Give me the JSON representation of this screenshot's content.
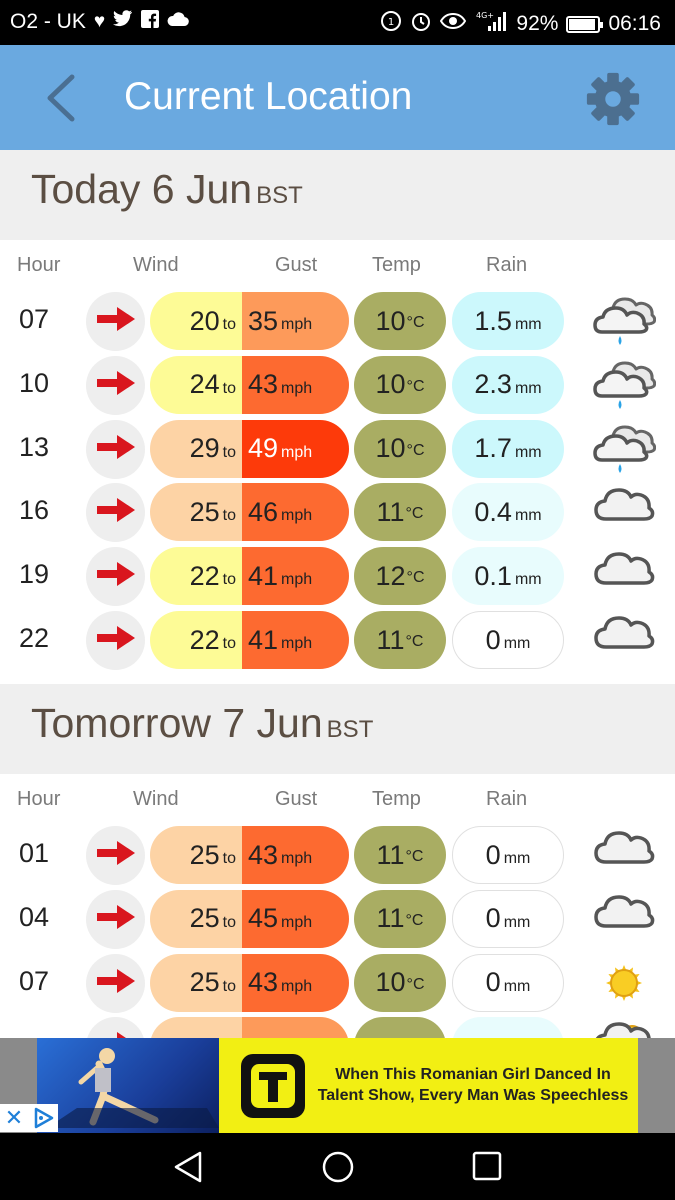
{
  "status_bar": {
    "carrier": "O2 - UK",
    "network": "4G+",
    "battery": "92%",
    "battery_level": 0.92,
    "time": "06:16",
    "icons": [
      "heart-icon",
      "twitter-icon",
      "facebook-icon",
      "cloud-icon",
      "data-saver-icon",
      "alarm-icon",
      "eye-icon",
      "signal-icon",
      "battery-icon"
    ]
  },
  "app_bar": {
    "title": "Current Location",
    "back_icon": "chevron-left-icon",
    "settings_icon": "gear-icon"
  },
  "columns": {
    "hour": "Hour",
    "wind": "Wind",
    "gust": "Gust",
    "temp": "Temp",
    "rain": "Rain"
  },
  "labels": {
    "to": "to",
    "mph": "mph",
    "celsius": "°C",
    "mm": "mm"
  },
  "colors": {
    "appbar": "#6aa9e0",
    "wind_arrow": "#d9161e",
    "temp_pill": "#a9ad63",
    "rain_light": "#ccf8fc",
    "rain_faint": "#e8fcfd",
    "rain_none": "#ffffff"
  },
  "days": [
    {
      "title": "Today 6 Jun",
      "tz": "BST",
      "rows": [
        {
          "hour": "07",
          "wind": "20",
          "gust": "35",
          "temp": "10",
          "rain": "1.5",
          "wind_color": "#fdfb96",
          "gust_color": "#fd9a5a",
          "gust_text": "#222222",
          "rain_color": "#ccf8fc",
          "icon": "rain-cloud-icon"
        },
        {
          "hour": "10",
          "wind": "24",
          "gust": "43",
          "temp": "10",
          "rain": "2.3",
          "wind_color": "#fdfb96",
          "gust_color": "#fd6a30",
          "gust_text": "#222222",
          "rain_color": "#ccf8fc",
          "icon": "rain-cloud-icon"
        },
        {
          "hour": "13",
          "wind": "29",
          "gust": "49",
          "temp": "10",
          "rain": "1.7",
          "wind_color": "#fdd3a5",
          "gust_color": "#fd3a0a",
          "gust_text": "#ffffff",
          "rain_color": "#ccf8fc",
          "icon": "rain-cloud-icon"
        },
        {
          "hour": "16",
          "wind": "25",
          "gust": "46",
          "temp": "11",
          "rain": "0.4",
          "wind_color": "#fdd3a5",
          "gust_color": "#fd6a30",
          "gust_text": "#222222",
          "rain_color": "#e8fcfd",
          "icon": "cloud-icon"
        },
        {
          "hour": "19",
          "wind": "22",
          "gust": "41",
          "temp": "12",
          "rain": "0.1",
          "wind_color": "#fdfb96",
          "gust_color": "#fd6a30",
          "gust_text": "#222222",
          "rain_color": "#e8fcfd",
          "icon": "cloud-icon"
        },
        {
          "hour": "22",
          "wind": "22",
          "gust": "41",
          "temp": "11",
          "rain": "0",
          "wind_color": "#fdfb96",
          "gust_color": "#fd6a30",
          "gust_text": "#222222",
          "rain_color": "#ffffff",
          "icon": "cloud-icon"
        }
      ]
    },
    {
      "title": "Tomorrow 7 Jun",
      "tz": "BST",
      "rows": [
        {
          "hour": "01",
          "wind": "25",
          "gust": "43",
          "temp": "11",
          "rain": "0",
          "wind_color": "#fdd3a5",
          "gust_color": "#fd6a30",
          "gust_text": "#222222",
          "rain_color": "#ffffff",
          "icon": "cloud-icon"
        },
        {
          "hour": "04",
          "wind": "25",
          "gust": "45",
          "temp": "11",
          "rain": "0",
          "wind_color": "#fdd3a5",
          "gust_color": "#fd6a30",
          "gust_text": "#222222",
          "rain_color": "#ffffff",
          "icon": "cloud-icon"
        },
        {
          "hour": "07",
          "wind": "25",
          "gust": "43",
          "temp": "10",
          "rain": "0",
          "wind_color": "#fdd3a5",
          "gust_color": "#fd6a30",
          "gust_text": "#222222",
          "rain_color": "#ffffff",
          "icon": "sun-icon"
        },
        {
          "hour": "",
          "wind": "",
          "gust": "",
          "temp": "",
          "rain": "",
          "wind_color": "#fdd3a5",
          "gust_color": "#fd9a5a",
          "gust_text": "#222222",
          "rain_color": "#e8fcfd",
          "icon": "sun-cloud-icon"
        }
      ]
    }
  ],
  "ad": {
    "text": "When This Romanian Girl Danced In Talent Show, Every Man Was Speechless",
    "logo_letter": "T",
    "close_icon": "close-icon",
    "adchoices_icon": "adchoices-icon"
  },
  "nav_bar": {
    "icons": [
      "back-triangle-icon",
      "home-circle-icon",
      "recents-square-icon"
    ]
  }
}
